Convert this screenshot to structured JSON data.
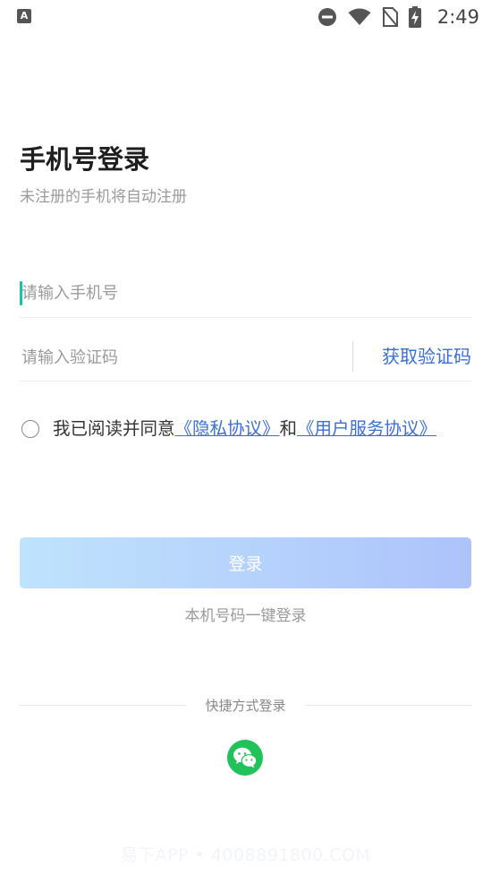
{
  "status_bar": {
    "left_icon": "A",
    "left_icon_name": "app-notification-icon",
    "icons": [
      "do-not-disturb-icon",
      "wifi-icon",
      "no-sim-icon",
      "battery-charging-icon"
    ],
    "time": "2:49"
  },
  "header": {
    "title": "手机号登录",
    "subtitle": "未注册的手机将自动注册"
  },
  "form": {
    "phone_placeholder": "请输入手机号",
    "phone_value": "",
    "code_placeholder": "请输入验证码",
    "code_value": "",
    "get_code_label": "获取验证码"
  },
  "agreement": {
    "checked": false,
    "prefix": "我已阅读并同意",
    "privacy_link": "《隐私协议》",
    "conjunction": "和",
    "service_link": "《用户服务协议》"
  },
  "actions": {
    "login_label": "登录",
    "one_click_label": "本机号码一键登录"
  },
  "quick_login": {
    "label": "快捷方式登录",
    "methods": [
      "wechat-icon"
    ]
  },
  "colors": {
    "accent": "#3a6fd8",
    "caret": "#18c4a8",
    "login_gradient_start": "#bfe3fd",
    "login_gradient_end": "#adc3fb",
    "wechat": "#20c25a"
  },
  "watermark": "易下APP • 4008891800.COM"
}
